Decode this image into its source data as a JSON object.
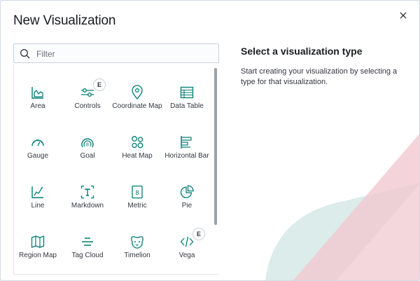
{
  "modal": {
    "title": "New Visualization",
    "close_icon": "close-icon",
    "search": {
      "placeholder": "Filter",
      "value": "",
      "icon": "search-icon"
    },
    "info": {
      "title": "Select a visualization type",
      "description": "Start creating your visualization by selecting a type for that visualization."
    }
  },
  "types": [
    {
      "label": "Area",
      "icon": "area-chart-icon"
    },
    {
      "label": "Controls",
      "icon": "controls-icon",
      "badge": "E"
    },
    {
      "label": "Coordinate Map",
      "icon": "map-pin-icon"
    },
    {
      "label": "Data Table",
      "icon": "table-icon"
    },
    {
      "label": "Gauge",
      "icon": "gauge-icon"
    },
    {
      "label": "Goal",
      "icon": "goal-icon"
    },
    {
      "label": "Heat Map",
      "icon": "heatmap-icon"
    },
    {
      "label": "Horizontal Bar",
      "icon": "horizontal-bar-icon"
    },
    {
      "label": "Line",
      "icon": "line-chart-icon"
    },
    {
      "label": "Markdown",
      "icon": "markdown-icon"
    },
    {
      "label": "Metric",
      "icon": "metric-icon"
    },
    {
      "label": "Pie",
      "icon": "pie-chart-icon"
    },
    {
      "label": "Region Map",
      "icon": "region-map-icon"
    },
    {
      "label": "Tag Cloud",
      "icon": "tag-cloud-icon"
    },
    {
      "label": "Timelion",
      "icon": "timelion-icon"
    },
    {
      "label": "Vega",
      "icon": "vega-code-icon",
      "badge": "E"
    }
  ],
  "colors": {
    "icon": "#017d73",
    "text": "#343741",
    "title": "#1a1c21",
    "deco_pink": "#f2c4cd",
    "deco_teal": "#bfe0dc"
  }
}
